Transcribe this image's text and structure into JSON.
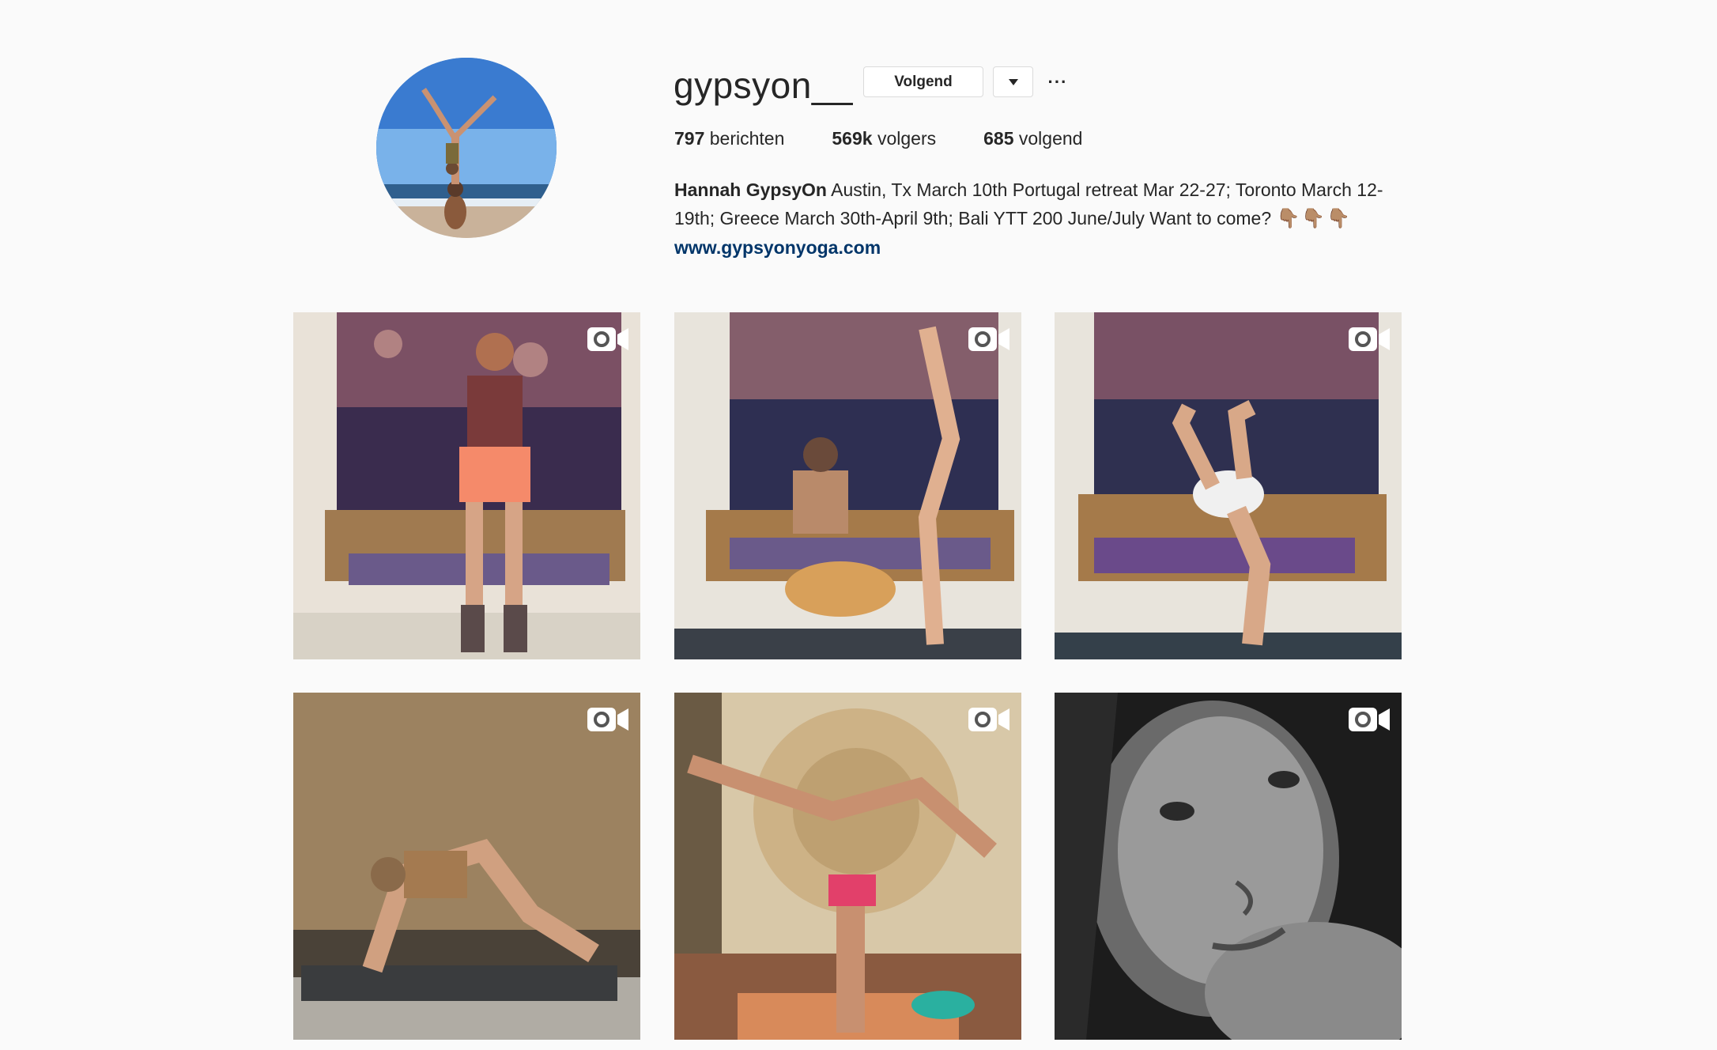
{
  "profile": {
    "username": "gypsyon__",
    "follow_label": "Volgend",
    "more_label": "···",
    "stats": {
      "posts_count": "797",
      "posts_label": "berichten",
      "followers_count": "569k",
      "followers_label": "volgers",
      "following_count": "685",
      "following_label": "volgend"
    },
    "bio": {
      "name": "Hannah GypsyOn",
      "text": " Austin, Tx March 10th Portugal retreat Mar 22-27; Toronto March 12-19th; Greece March 30th-April 9th; Bali YTT 200 June/July Want to come? ",
      "emoji": "👇🏽👇🏽👇🏽",
      "link": "www.gypsyonyoga.com"
    }
  },
  "posts": [
    {
      "type": "video",
      "icon": "video-camera-icon"
    },
    {
      "type": "video",
      "icon": "video-camera-icon"
    },
    {
      "type": "video",
      "icon": "video-camera-icon"
    },
    {
      "type": "video",
      "icon": "video-camera-icon"
    },
    {
      "type": "video",
      "icon": "video-camera-icon"
    },
    {
      "type": "video",
      "icon": "video-camera-icon"
    }
  ],
  "colors": {
    "background": "#fafafa",
    "text": "#262626",
    "link": "#003569",
    "border": "#dbdbdb"
  }
}
